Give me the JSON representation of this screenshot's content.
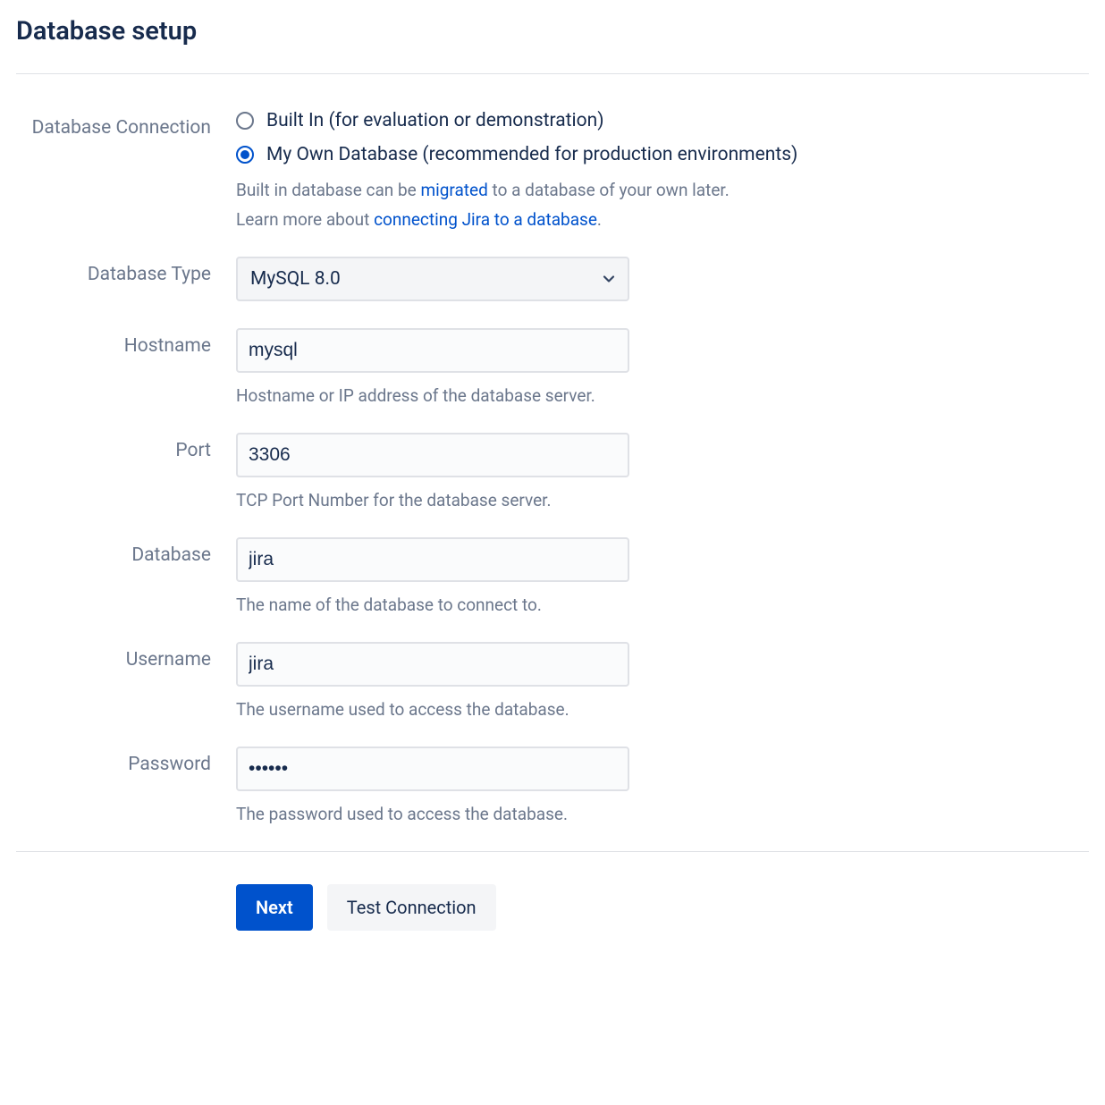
{
  "title": "Database setup",
  "connection": {
    "label": "Database Connection",
    "options": {
      "builtin": "Built In (for evaluation or demonstration)",
      "own": "My Own Database (recommended for production environments)"
    },
    "help1_prefix": "Built in database can be ",
    "help1_link": "migrated",
    "help1_suffix": " to a database of your own later.",
    "help2_prefix": "Learn more about ",
    "help2_link": "connecting Jira to a database",
    "help2_suffix": "."
  },
  "type": {
    "label": "Database Type",
    "value": "MySQL 8.0"
  },
  "hostname": {
    "label": "Hostname",
    "value": "mysql",
    "help": "Hostname or IP address of the database server."
  },
  "port": {
    "label": "Port",
    "value": "3306",
    "help": "TCP Port Number for the database server."
  },
  "database": {
    "label": "Database",
    "value": "jira",
    "help": "The name of the database to connect to."
  },
  "username": {
    "label": "Username",
    "value": "jira",
    "help": "The username used to access the database."
  },
  "password": {
    "label": "Password",
    "value": "••••••",
    "help": "The password used to access the database."
  },
  "buttons": {
    "next": "Next",
    "test": "Test Connection"
  }
}
